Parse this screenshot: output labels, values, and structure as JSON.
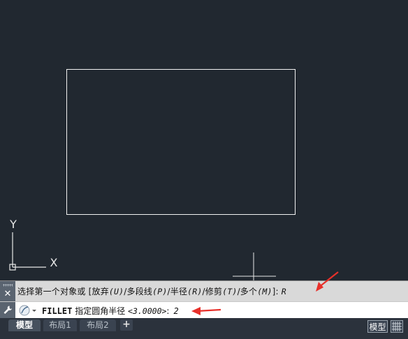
{
  "command_history": {
    "prompt": "选择第一个对象或 [放弃",
    "opt_undo": "(U)",
    "seg2": "/多段线",
    "opt_pline": "(P)",
    "seg3": "/半径",
    "opt_radius": "(R)",
    "seg4": "/修剪",
    "opt_trim": "(T)",
    "seg5": "/多个",
    "opt_multi": "(M)",
    "seg6": "]: ",
    "entered": "R"
  },
  "command_line": {
    "command": "FILLET",
    "prompt": "指定圆角半径",
    "default": "<3.0000>",
    "colon": ":",
    "entered": "2"
  },
  "ucs": {
    "x_label": "X",
    "y_label": "Y"
  },
  "tabs": {
    "model": "模型",
    "layout1": "布局1",
    "layout2": "布局2",
    "add": "+"
  },
  "status": {
    "model_button": "模型"
  },
  "colors": {
    "canvas": "#212830",
    "annotation_arrow": "#e8302a"
  },
  "icons": {
    "close": "close-icon",
    "customize": "wrench-icon",
    "recent_commands": "command-icon",
    "grid": "grid-icon"
  }
}
